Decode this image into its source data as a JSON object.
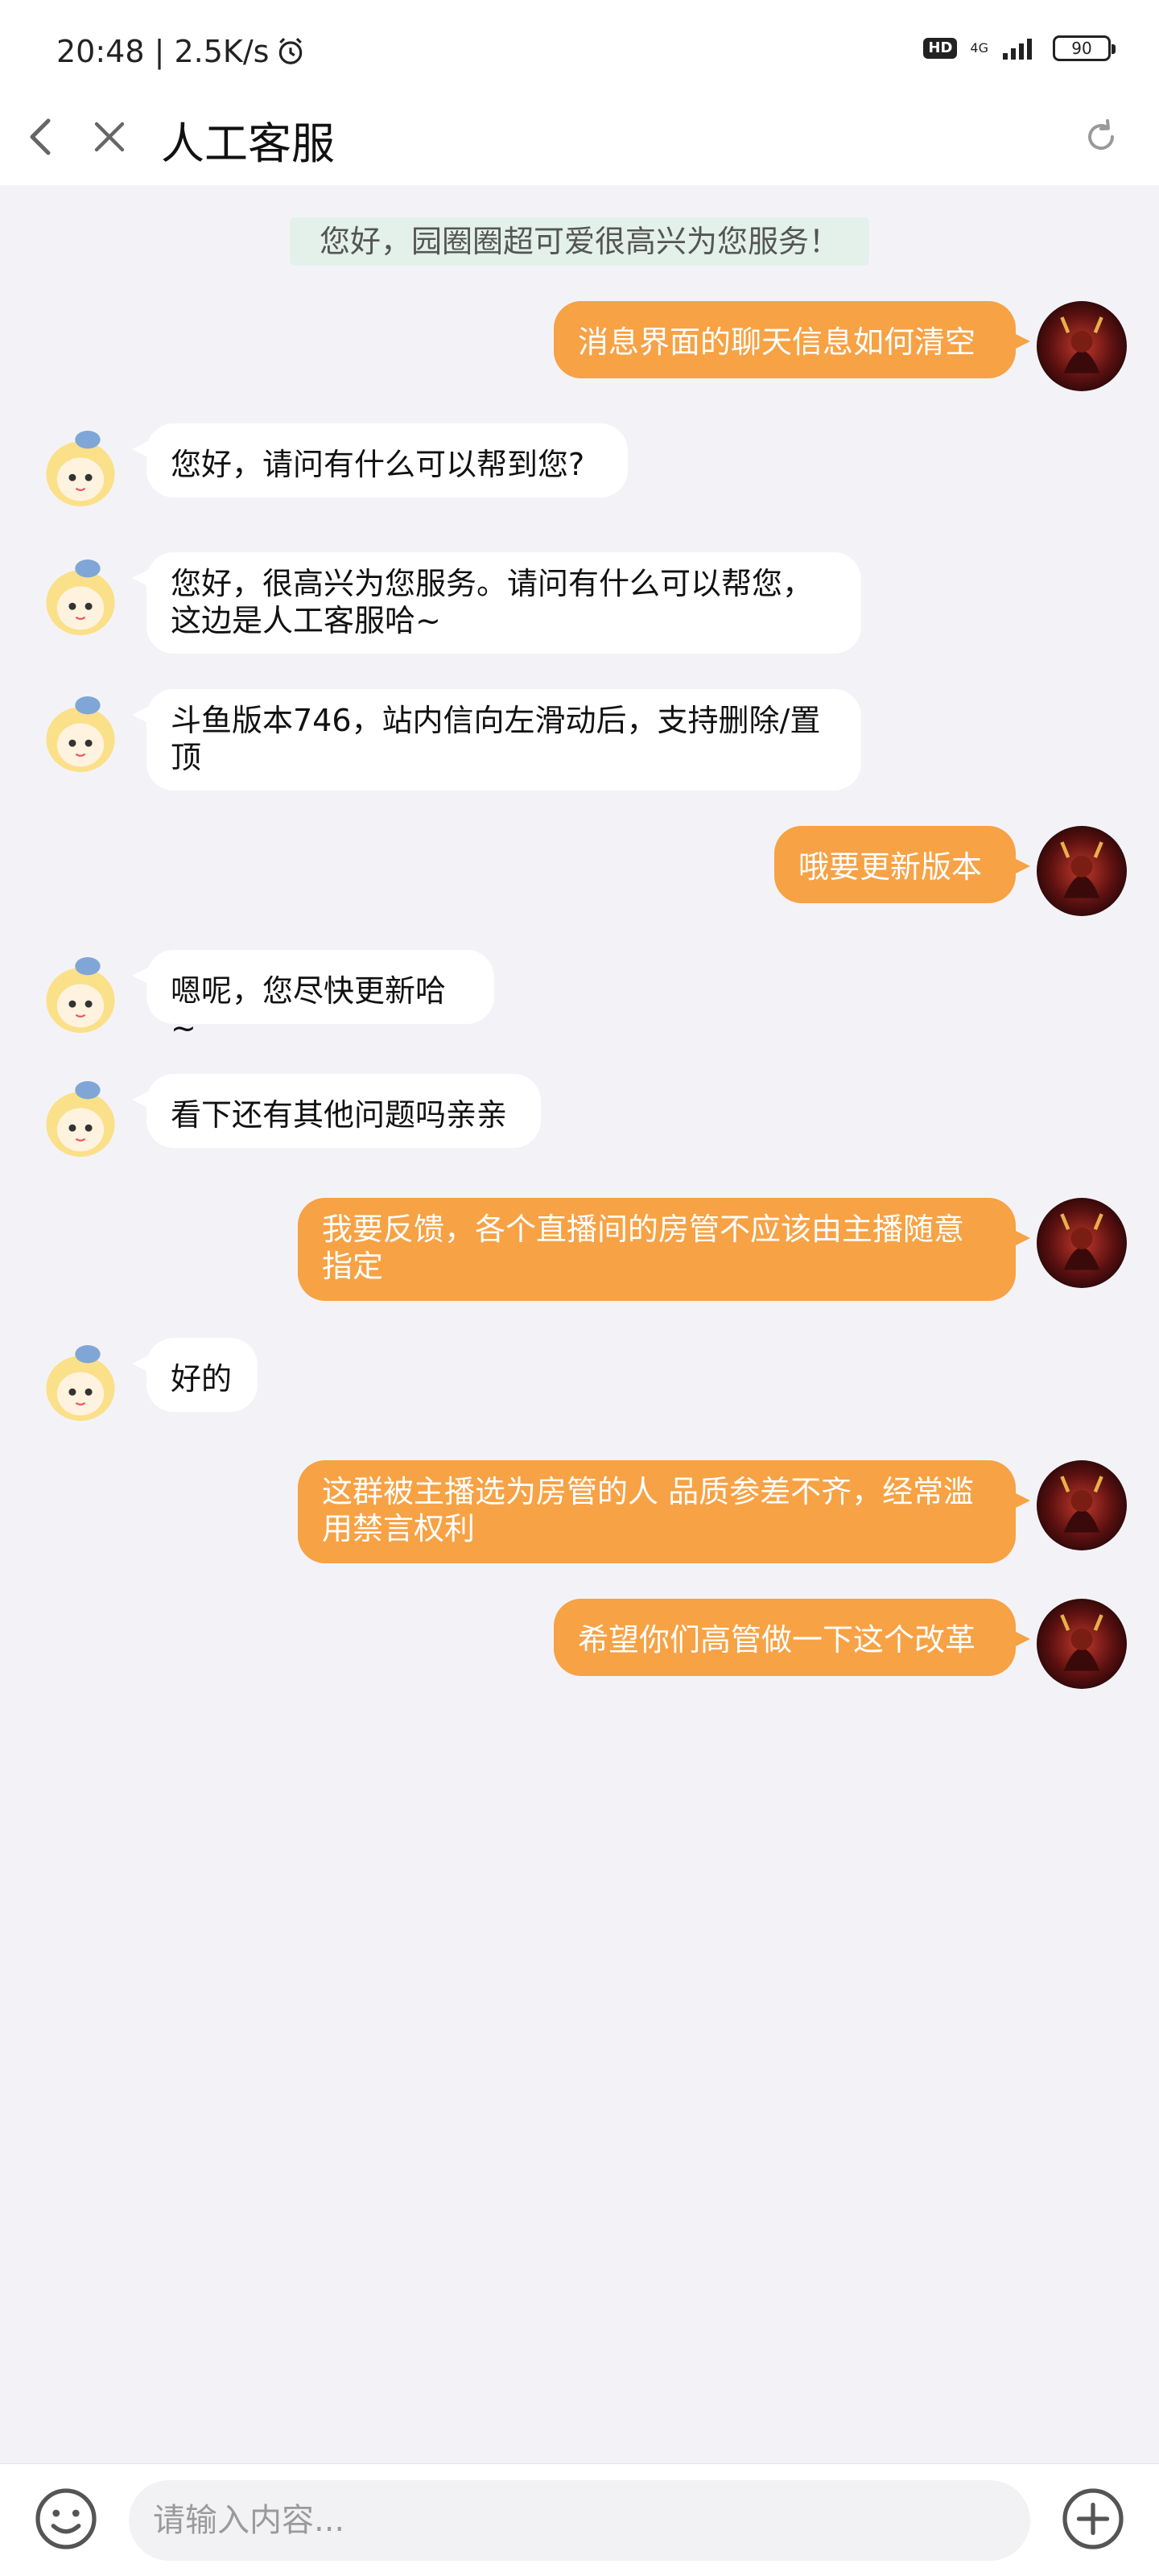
{
  "status_bar": {
    "time_speed": "20:48 | 2.5K/s",
    "hd": "HD",
    "network": "4G",
    "battery": "90"
  },
  "nav": {
    "title": "人工客服"
  },
  "chat": {
    "system_notice": "您好，园圈圈超可爱很高兴为您服务！",
    "messages": [
      {
        "sender": "user",
        "text": "消息界面的聊天信息如何清空"
      },
      {
        "sender": "agent",
        "text": "您好，请问有什么可以帮到您?"
      },
      {
        "sender": "agent",
        "text": "您好，很高兴为您服务。请问有什么可以帮您，这边是人工客服哈~"
      },
      {
        "sender": "agent",
        "text": "斗鱼版本746，站内信向左滑动后，支持删除/置顶"
      },
      {
        "sender": "user",
        "text": "哦要更新版本"
      },
      {
        "sender": "agent",
        "text": "嗯呢，您尽快更新哈~"
      },
      {
        "sender": "agent",
        "text": "看下还有其他问题吗亲亲"
      },
      {
        "sender": "user",
        "text": "我要反馈，各个直播间的房管不应该由主播随意指定"
      },
      {
        "sender": "agent",
        "text": "好的"
      },
      {
        "sender": "user",
        "text": "这群被主播选为房管的人 品质参差不齐，经常滥用禁言权利"
      },
      {
        "sender": "user",
        "text": "希望你们高管做一下这个改革"
      }
    ]
  },
  "input": {
    "placeholder": "请输入内容..."
  },
  "colors": {
    "outgoing_bubble": "#f6a245",
    "incoming_bubble": "#ffffff",
    "chat_background": "#f3f3f7",
    "notice_background": "#e3f1ea"
  }
}
